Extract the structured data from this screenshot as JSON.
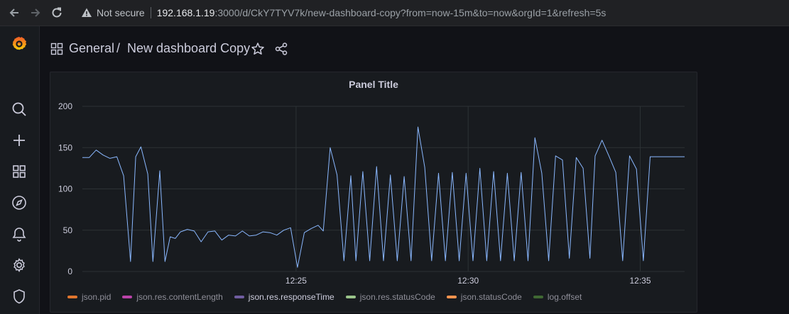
{
  "browser": {
    "security_label": "Not secure",
    "url_host": "192.168.1.19",
    "url_rest": ":3000/d/CkY7TYV7k/new-dashboard-copy?from=now-15m&to=now&orgId=1&refresh=5s"
  },
  "sidemenu": {
    "items": [
      "grafana-logo-icon",
      "search-icon",
      "plus-icon",
      "dashboards-icon",
      "explore-icon",
      "alerting-icon",
      "configuration-icon",
      "shield-icon"
    ]
  },
  "header": {
    "folder": "General",
    "separator": "/",
    "title": "New dashboard Copy"
  },
  "panel": {
    "title": "Panel Title"
  },
  "colors": {
    "series_line": "#8ab8ff",
    "grid": "#2c3235",
    "legend_json_pid": "#e0752d",
    "legend_content_length": "#ba43a9",
    "legend_response_time": "#705da0",
    "legend_res_status": "#9ac48a",
    "legend_status_code": "#f9934e",
    "legend_log_offset": "#3f6833"
  },
  "chart_data": {
    "type": "line",
    "title": "Panel Title",
    "ylim": [
      0,
      200
    ],
    "yticks": [
      "0",
      "50",
      "100",
      "150",
      "200"
    ],
    "xticks": [
      {
        "label": "12:25",
        "value": 12.42
      },
      {
        "label": "12:30",
        "value": 22.42
      },
      {
        "label": "12:35",
        "value": 32.42
      }
    ],
    "xlim": [
      0,
      30.2
    ],
    "legend": [
      {
        "name": "json.pid",
        "color": "#e0752d",
        "active": false
      },
      {
        "name": "json.res.contentLength",
        "color": "#ba43a9",
        "active": false
      },
      {
        "name": "json.res.responseTime",
        "color": "#705da0",
        "active": true
      },
      {
        "name": "json.res.statusCode",
        "color": "#9ac48a",
        "active": false
      },
      {
        "name": "json.statusCode",
        "color": "#f9934e",
        "active": false
      },
      {
        "name": "log.offset",
        "color": "#3f6833",
        "active": false
      }
    ],
    "series": [
      {
        "name": "json.res.responseTime",
        "x": [
          0,
          0.4,
          0.8,
          1.2,
          1.6,
          2.0,
          2.4,
          2.8,
          3.1,
          3.4,
          3.8,
          4.1,
          4.5,
          4.8,
          5.1,
          5.4,
          5.7,
          6.1,
          6.5,
          6.9,
          7.3,
          7.7,
          8.1,
          8.5,
          8.9,
          9.3,
          9.7,
          10.1,
          10.5,
          10.9,
          11.3,
          11.7,
          12.1,
          12.5,
          12.9,
          13.3,
          13.7,
          14.0,
          14.4,
          14.8,
          15.2,
          15.6,
          15.9,
          16.3,
          16.7,
          17.1,
          17.5,
          17.9,
          18.3,
          18.7,
          19.1,
          19.5,
          19.9,
          20.3,
          20.7,
          21.1,
          21.5,
          21.9,
          22.3,
          22.7,
          23.1,
          23.5,
          23.9,
          24.3,
          24.7,
          25.1,
          25.5,
          25.9,
          26.3,
          26.7,
          27.1,
          27.5,
          27.9,
          28.3,
          28.7,
          29.1,
          29.5,
          29.8,
          30.2,
          30.6,
          31.0,
          31.4,
          31.8,
          32.2,
          32.6,
          33.0,
          33.4,
          33.8,
          34.2,
          34.6,
          35.0
        ],
        "values": [
          138,
          138,
          147,
          141,
          137,
          139,
          116,
          12,
          139,
          151,
          118,
          12,
          122,
          12,
          42,
          40,
          48,
          51,
          49,
          36,
          48,
          49,
          38,
          44,
          43,
          49,
          43,
          44,
          48,
          47,
          44,
          50,
          53,
          5,
          47,
          52,
          56,
          49,
          150,
          117,
          13,
          116,
          13,
          121,
          13,
          127,
          13,
          117,
          13,
          115,
          13,
          175,
          126,
          13,
          119,
          13,
          120,
          13,
          119,
          13,
          125,
          13,
          121,
          13,
          119,
          13,
          120,
          13,
          162,
          119,
          13,
          140,
          135,
          16,
          138,
          125,
          16,
          140,
          159,
          140,
          120,
          13,
          140,
          124,
          13,
          139,
          139,
          139,
          139,
          139,
          139
        ]
      }
    ]
  }
}
